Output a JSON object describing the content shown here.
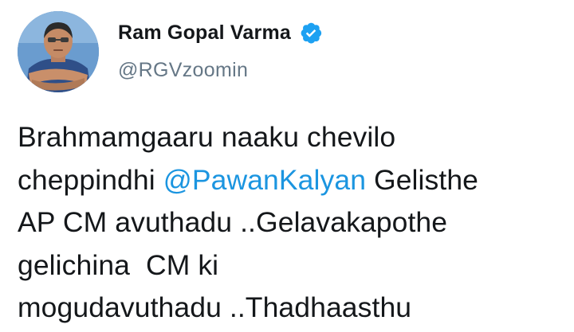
{
  "user": {
    "display_name": "Ram Gopal Varma",
    "handle": "@RGVzoomin",
    "verified": true,
    "verified_icon": "verified-badge-icon",
    "avatar": "profile-photo"
  },
  "tweet": {
    "lines": [
      {
        "before": "Brahmamgaaru naaku chevilo",
        "mention": "",
        "after": ""
      },
      {
        "before": "cheppindhi ",
        "mention": "@PawanKalyan",
        "after": " Gelisthe"
      },
      {
        "before": "AP CM avuthadu ..Gelavakapothe",
        "mention": "",
        "after": ""
      },
      {
        "before": "gelichina  CM ki",
        "mention": "",
        "after": ""
      },
      {
        "before": "mogudavuthadu ..Thadhaasthu",
        "mention": "",
        "after": ""
      }
    ]
  },
  "colors": {
    "text": "#14171a",
    "secondary": "#657786",
    "link": "#1b95e0",
    "verified": "#1da1f2"
  }
}
